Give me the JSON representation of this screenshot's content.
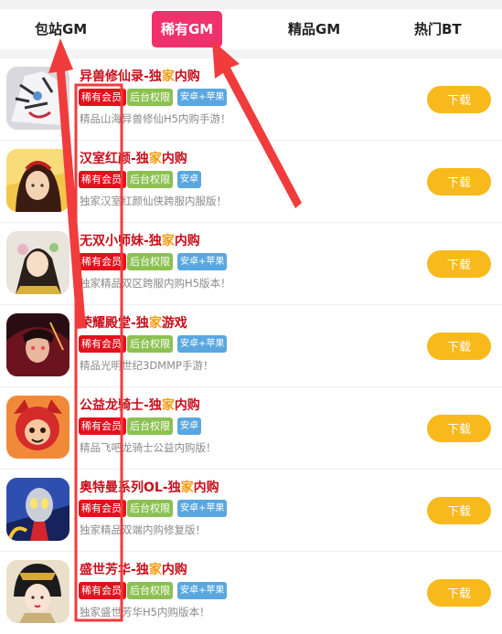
{
  "tabs": [
    {
      "label": "包站GM",
      "active": false
    },
    {
      "label": "稀有GM",
      "active": true
    },
    {
      "label": "精品GM",
      "active": false
    },
    {
      "label": "热门BT",
      "active": false
    }
  ],
  "download_label": "下载",
  "games": [
    {
      "title_a": "异兽修仙录-独",
      "title_hl": "家",
      "title_b": "内购",
      "tags": [
        "稀有会员",
        "后台权限",
        "安卓+苹果"
      ],
      "desc": "精品山海异兽修仙H5内购手游！"
    },
    {
      "title_a": "汉室红颜-独",
      "title_hl": "家",
      "title_b": "内购",
      "tags": [
        "稀有会员",
        "后台权限",
        "安卓"
      ],
      "desc": "独家汉室红颜仙侠跨服内服版！"
    },
    {
      "title_a": "无双小师妹-独",
      "title_hl": "家",
      "title_b": "内购",
      "tags": [
        "稀有会员",
        "后台权限",
        "安卓+苹果"
      ],
      "desc": "独家精品双区跨服内购H5版本！"
    },
    {
      "title_a": "荣耀殿堂-独",
      "title_hl": "家",
      "title_b": "游戏",
      "tags": [
        "稀有会员",
        "后台权限",
        "安卓+苹果"
      ],
      "desc": "精品光明世纪3DMMP手游！"
    },
    {
      "title_a": "公益龙骑士-独",
      "title_hl": "家",
      "title_b": "内购",
      "tags": [
        "稀有会员",
        "后台权限",
        "安卓"
      ],
      "desc": "精品飞吧龙骑士公益内购版！"
    },
    {
      "title_a": "奥特曼系列OL-独",
      "title_hl": "家",
      "title_b": "内购",
      "tags": [
        "稀有会员",
        "后台权限",
        "安卓+苹果"
      ],
      "desc": "独家精品双端内购修复版！"
    },
    {
      "title_a": "盛世芳华-独",
      "title_hl": "家",
      "title_b": "内购",
      "tags": [
        "稀有会员",
        "后台权限",
        "安卓+苹果"
      ],
      "desc": "独家盛世芳华H5内购版本！"
    }
  ],
  "colors": {
    "active_tab": "#f0316c",
    "title": "#c70f1b",
    "highlight": "#f39c12",
    "tag_vip": "#e3111d",
    "tag_admin": "#8cc152",
    "tag_platform": "#5aa7e0",
    "download": "#f8b91c",
    "annotation": "#f03c3c"
  },
  "icons": [
    "tiger-game-icon",
    "heroine-game-icon",
    "girl-game-icon",
    "warrior-game-icon",
    "dragon-knight-game-icon",
    "ultraman-game-icon",
    "empress-game-icon"
  ]
}
